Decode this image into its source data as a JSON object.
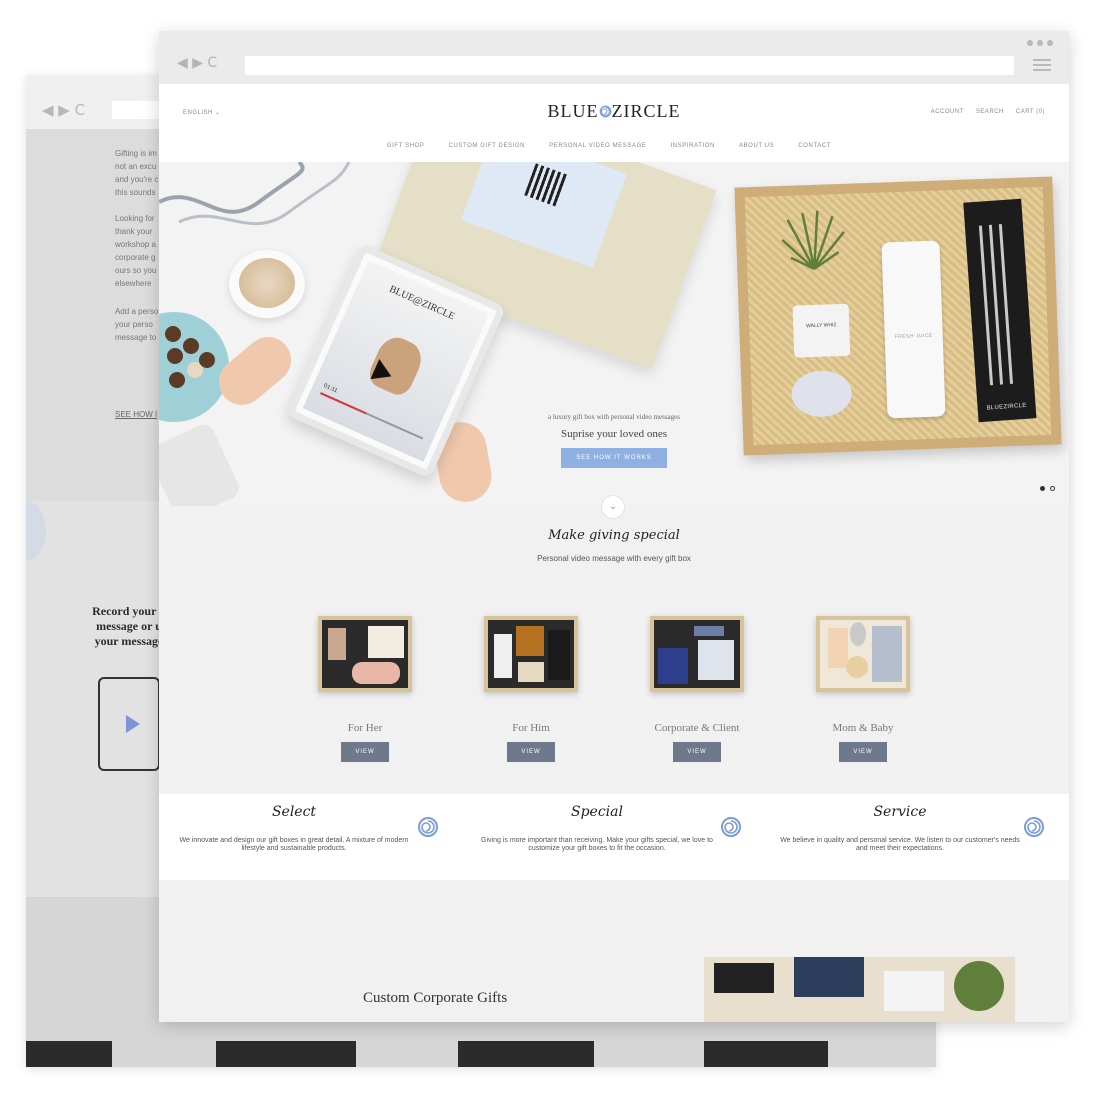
{
  "back_window": {
    "nav_glyphs": "◀ ▶ C",
    "paragraphs": [
      [
        "Gifting is im",
        "not an excu",
        "and you're c",
        "this sounds"
      ],
      [
        "Looking for",
        "thank your",
        "workshop a",
        "corporate g",
        "ours so you",
        "elsewhere"
      ],
      [
        "Add a perso",
        "your perso",
        "message to"
      ]
    ],
    "link": "SEE HOW I",
    "record_text": "Record your p\nmessage or u\nyour message"
  },
  "browser": {
    "nav_glyphs": "◀ ▶ C"
  },
  "header": {
    "language": "ENGLISH ⌄",
    "logo_left": "BLUE",
    "logo_right": "ZIRCLE",
    "account": "ACCOUNT",
    "search": "SEARCH",
    "cart": "CART (0)"
  },
  "nav": {
    "items": [
      "GIFT SHOP",
      "CUSTOM GIFT DESIGN",
      "PERSONAL VIDEO MESSAGE",
      "INSPIRATION",
      "ABOUT US",
      "CONTACT"
    ]
  },
  "hero": {
    "tablet_logo": "BLUE@ZIRCLE",
    "tablet_time": "01:11",
    "jar_label": "WALLY\nWHIZ",
    "bottle_label": "FRESH\nJUICE",
    "pouch_label": "BLUEZIRCLE",
    "subtitle": "a luxury gift box with personal video messages",
    "title": "Suprise your loved ones",
    "button": "SEE HOW IT WORKS"
  },
  "special": {
    "title": "Make giving special",
    "subtitle": "Personal video message with every gift box",
    "categories": [
      {
        "label": "For Her",
        "button": "VIEW"
      },
      {
        "label": "For Him",
        "button": "VIEW"
      },
      {
        "label": "Corporate & Client",
        "button": "VIEW"
      },
      {
        "label": "Mom & Baby",
        "button": "VIEW"
      }
    ]
  },
  "pillars": [
    {
      "title": "Select",
      "text": "We innovate and design our gift boxes in great detail. A mixture of modern lifestyle and sustainable products."
    },
    {
      "title": "Special",
      "text": "Giving is more important than receiving. Make your gifts special, we love to customize your gift boxes to fit the occasion."
    },
    {
      "title": "Service",
      "text": "We believe in quality and personal service. We listen to our customer's needs and meet their expectations."
    }
  ],
  "corporate": {
    "title": "Custom Corporate Gifts"
  },
  "colors": {
    "accent_blue": "#8fb0e2",
    "view_button": "#6e7a8c",
    "swirl": "#7d9bd6"
  }
}
